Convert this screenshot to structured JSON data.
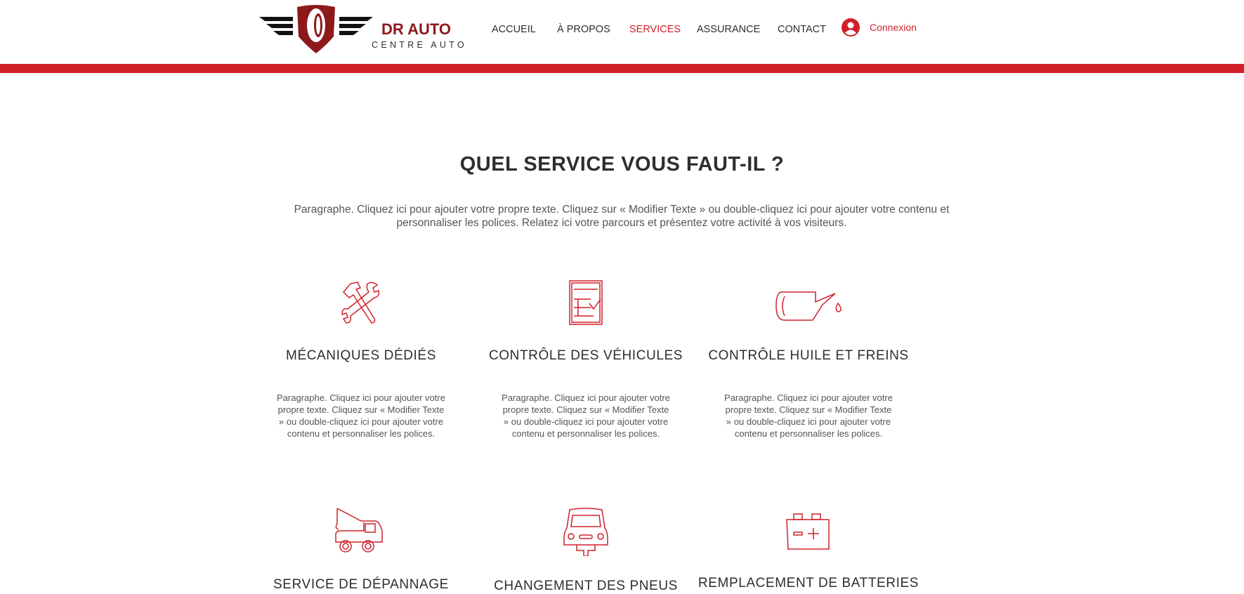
{
  "brand": {
    "name": "DR AUTO",
    "tagline": "CENTRE AUTO"
  },
  "nav": [
    {
      "label": "ACCUEIL",
      "active": false
    },
    {
      "label": "À PROPOS",
      "active": false
    },
    {
      "label": "SERVICES",
      "active": true
    },
    {
      "label": "ASSURANCE",
      "active": false
    },
    {
      "label": "CONTACT",
      "active": false
    }
  ],
  "login": {
    "label": "Connexion"
  },
  "colors": {
    "accent": "#d0202a",
    "brand": "#8c1a1d"
  },
  "main": {
    "title": "QUEL SERVICE VOUS FAUT-IL ?",
    "intro": "Paragraphe. Cliquez ici pour ajouter votre propre texte. Cliquez sur « Modifier Texte » ou double-cliquez ici pour ajouter votre contenu et personnaliser les polices. Relatez ici votre parcours et présentez votre activité à vos visiteurs.",
    "services": [
      {
        "icon": "tools-icon",
        "title": "MÉCANIQUES DÉDIÉS",
        "text": "Paragraphe. Cliquez ici pour ajouter votre propre texte. Cliquez sur « Modifier Texte » ou double-cliquez ici pour ajouter votre contenu et personnaliser les polices."
      },
      {
        "icon": "clipboard-check-icon",
        "title": "CONTRÔLE DES VÉHICULES",
        "text": "Paragraphe. Cliquez ici pour ajouter votre propre texte. Cliquez sur « Modifier Texte » ou double-cliquez ici pour ajouter votre contenu et personnaliser les polices."
      },
      {
        "icon": "oil-can-icon",
        "title": "CONTRÔLE HUILE ET FREINS",
        "text": "Paragraphe. Cliquez ici pour ajouter votre propre texte. Cliquez sur « Modifier Texte » ou double-cliquez ici pour ajouter votre contenu et personnaliser les polices."
      },
      {
        "icon": "tow-truck-icon",
        "title": "SERVICE DE DÉPANNAGE"
      },
      {
        "icon": "car-jack-icon",
        "title": "CHANGEMENT DES PNEUS"
      },
      {
        "icon": "battery-icon",
        "title": "REMPLACEMENT DE BATTERIES"
      }
    ]
  }
}
